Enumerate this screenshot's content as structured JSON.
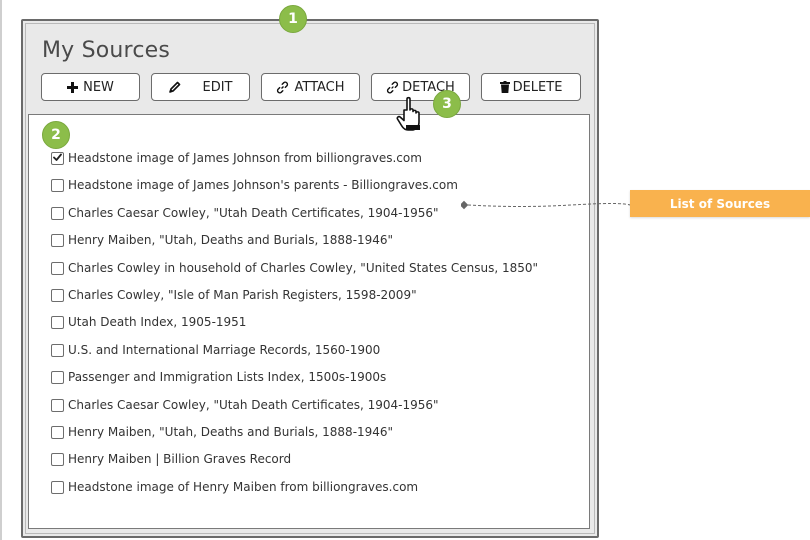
{
  "window": {
    "title": "My Sources"
  },
  "toolbar": {
    "new_label": "NEW",
    "edit_label": "EDIT",
    "attach_label": "ATTACH",
    "detach_label": "DETACH",
    "delete_label": "DELETE"
  },
  "sources": [
    {
      "label": "Headstone image of James Johnson from billiongraves.com",
      "checked": true
    },
    {
      "label": "Headstone image of James Johnson's parents - Billiongraves.com",
      "checked": false
    },
    {
      "label": "Charles Caesar Cowley, \"Utah Death Certificates, 1904-1956\"",
      "checked": false
    },
    {
      "label": "Henry Maiben, \"Utah, Deaths and Burials, 1888-1946\"",
      "checked": false
    },
    {
      "label": "Charles Cowley in household of Charles Cowley, \"United States Census, 1850\"",
      "checked": false
    },
    {
      "label": "Charles Cowley, \"Isle of Man Parish Registers, 1598-2009\"",
      "checked": false
    },
    {
      "label": "Utah Death Index, 1905-1951",
      "checked": false
    },
    {
      "label": "U.S. and International Marriage Records, 1560-1900",
      "checked": false
    },
    {
      "label": "Passenger and Immigration Lists Index, 1500s-1900s",
      "checked": false
    },
    {
      "label": "Charles Caesar Cowley, \"Utah Death Certificates, 1904-1956\"",
      "checked": false
    },
    {
      "label": "Henry Maiben, \"Utah, Deaths and Burials, 1888-1946\"",
      "checked": false
    },
    {
      "label": "Henry Maiben | Billion Graves Record",
      "checked": false
    },
    {
      "label": "Headstone image of Henry Maiben from billiongraves.com",
      "checked": false
    }
  ],
  "callouts": {
    "one": "1",
    "two": "2",
    "three": "3"
  },
  "annotation": {
    "label": "List of Sources"
  },
  "colors": {
    "badge_green": "#8cbd4a",
    "annotation_orange": "#f9b24e",
    "window_bg": "#e9e9e9"
  },
  "icons": {
    "new": "plus-icon",
    "edit": "pencil-icon",
    "attach": "link-icon",
    "detach": "broken-link-icon",
    "delete": "trash-icon",
    "cursor": "hand-pointer-icon"
  }
}
